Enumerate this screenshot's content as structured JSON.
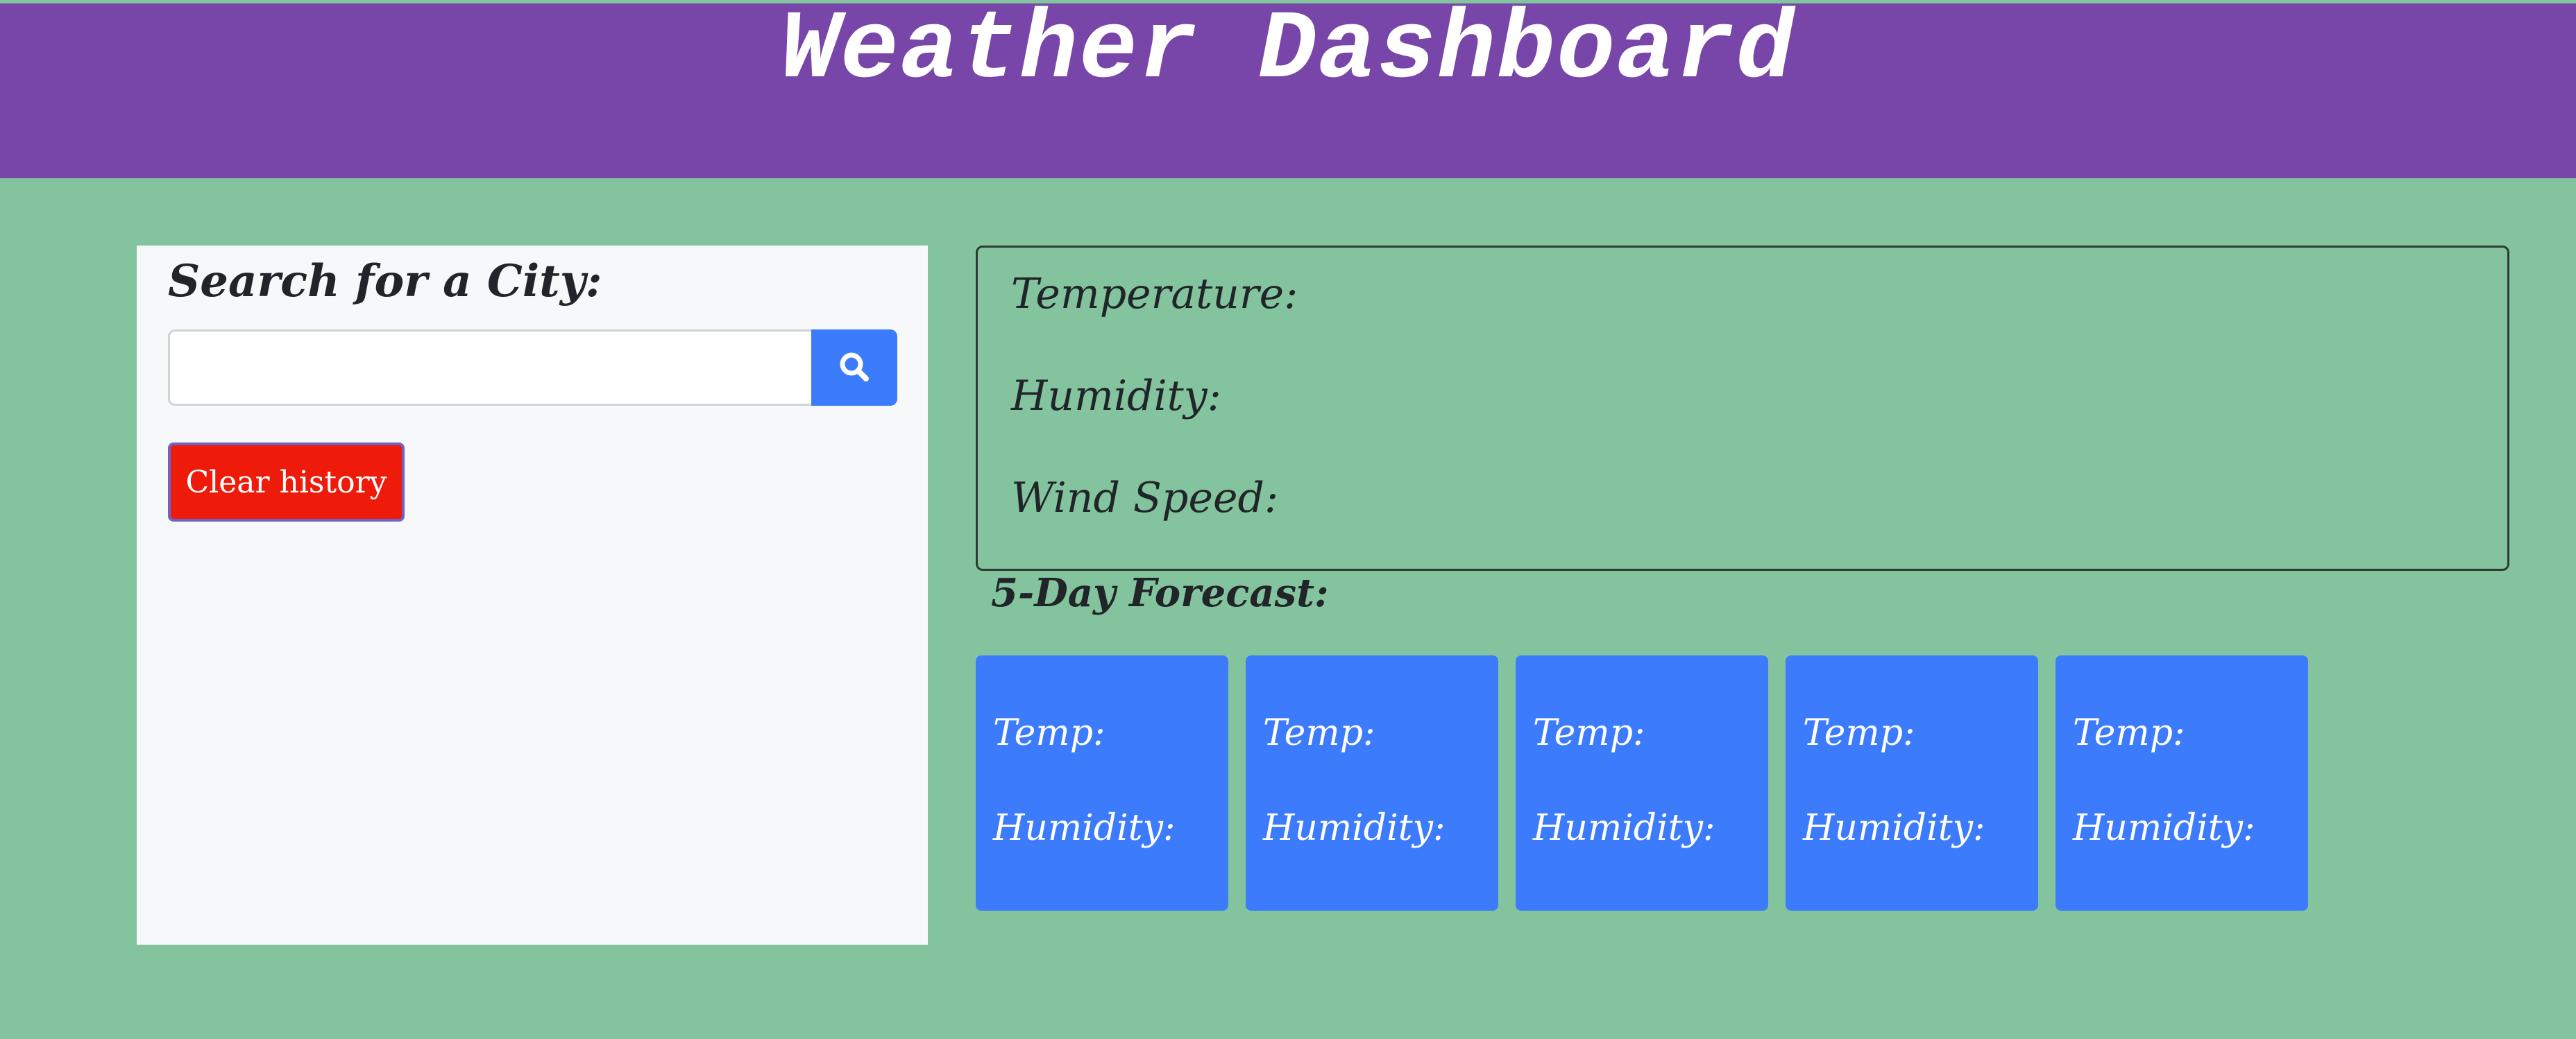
{
  "header": {
    "title": "Weather Dashboard"
  },
  "search": {
    "heading": "Search for a City:",
    "input_value": "",
    "input_placeholder": "",
    "button_icon": "search-icon",
    "clear_label": "Clear history"
  },
  "current": {
    "temperature_label": "Temperature:",
    "humidity_label": "Humidity:",
    "wind_label": "Wind Speed:"
  },
  "forecast": {
    "heading": "5-Day Forecast:",
    "cards": [
      {
        "temp_label": "Temp:",
        "humidity_label": "Humidity:"
      },
      {
        "temp_label": "Temp:",
        "humidity_label": "Humidity:"
      },
      {
        "temp_label": "Temp:",
        "humidity_label": "Humidity:"
      },
      {
        "temp_label": "Temp:",
        "humidity_label": "Humidity:"
      },
      {
        "temp_label": "Temp:",
        "humidity_label": "Humidity:"
      }
    ]
  },
  "colors": {
    "background": "#83c49e",
    "header": "#7845a8",
    "panel": "#f7f8fa",
    "primary": "#3b7bfc",
    "danger": "#ee1a0a"
  }
}
